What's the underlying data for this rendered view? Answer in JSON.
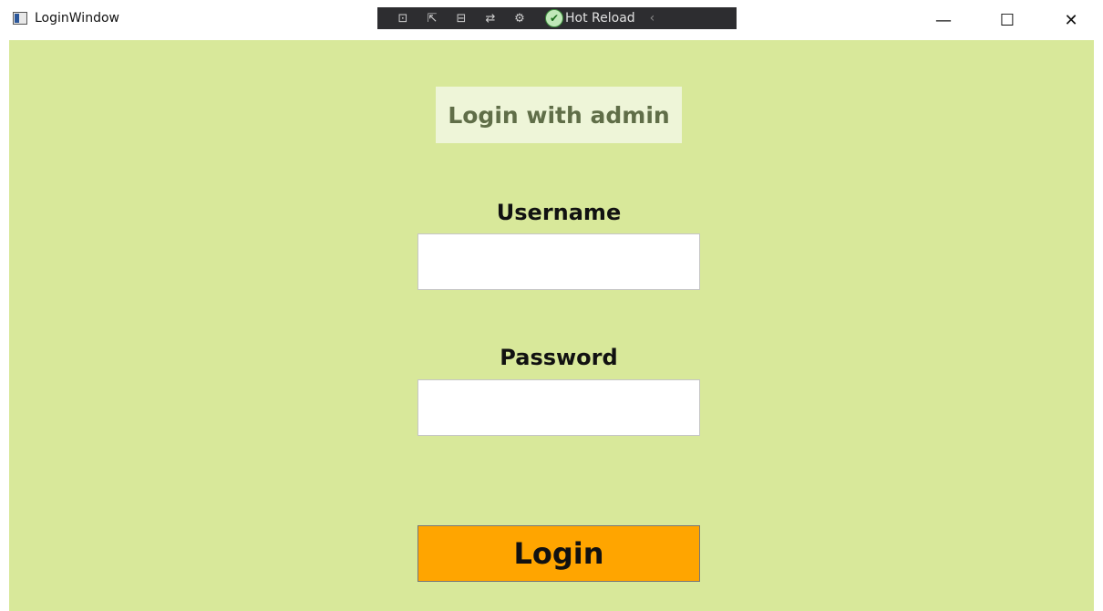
{
  "window": {
    "title": "LoginWindow",
    "icon": "app-window-icon",
    "controls": {
      "minimize": "—",
      "maximize": "☐",
      "close": "✕"
    }
  },
  "debug_toolbar": {
    "hot_reload_label": "Hot Reload",
    "icons": [
      "select-element-icon",
      "select-live-icon",
      "layout-adorners-icon",
      "track-focus-icon",
      "hot-reload-settings-icon"
    ]
  },
  "login": {
    "heading": "Login with admin",
    "username_label": "Username",
    "username_value": "",
    "password_label": "Password",
    "password_value": "",
    "button_label": "Login"
  },
  "colors": {
    "background": "#d8e89a",
    "heading_box": "#eef5d8",
    "heading_text": "#606e48",
    "button": "#ffa500"
  }
}
